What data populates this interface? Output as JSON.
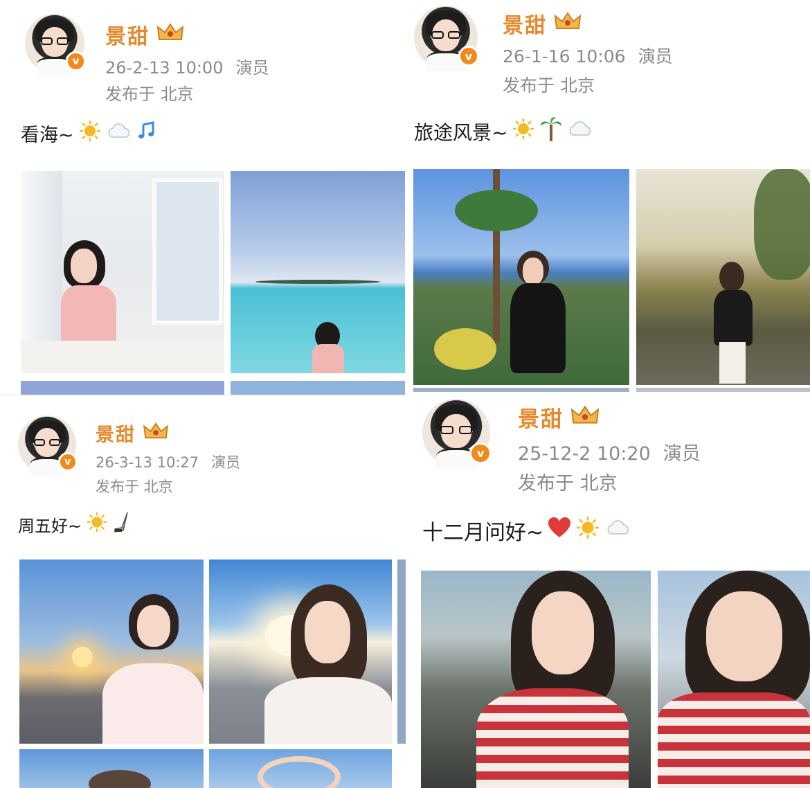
{
  "posts": [
    {
      "username": "景甜",
      "date": "26-2-13 10:00",
      "role": "演员",
      "location": "发布于 北京",
      "text": "看海~",
      "emojis": [
        "sun-icon",
        "cloud-icon",
        "music-note-icon"
      ]
    },
    {
      "username": "景甜",
      "date": "26-1-16 10:06",
      "role": "演员",
      "location": "发布于 北京",
      "text": "旅途风景~",
      "emojis": [
        "sun-icon",
        "palm-tree-icon",
        "cloud-icon"
      ]
    },
    {
      "username": "景甜",
      "date": "26-3-13 10:27",
      "role": "演员",
      "location": "发布于 北京",
      "text": "周五好~",
      "emojis": [
        "sun-icon",
        "hockey-stick-icon"
      ]
    },
    {
      "username": "景甜",
      "date": "25-12-2 10:20",
      "role": "演员",
      "location": "发布于 北京",
      "text": "十二月问好~",
      "emojis": [
        "heart-icon",
        "sun-icon",
        "cloud-icon"
      ]
    }
  ],
  "badge": {
    "verified_letter": "v"
  },
  "colors": {
    "username": "#e68a2e",
    "meta": "#8a8a8a",
    "verified": "#f08a1c"
  }
}
